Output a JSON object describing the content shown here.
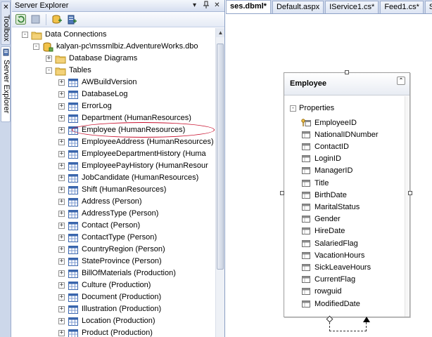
{
  "side_strip": {
    "toolbox_label": "Toolbox",
    "server_explorer_label": "Server Explorer"
  },
  "panel": {
    "title": "Server Explorer"
  },
  "tree": [
    {
      "label": "Data Connections",
      "icon": "folder-icon",
      "indent": 0,
      "exp": "-"
    },
    {
      "label": "kalyan-pc\\mssmlbiz.AdventureWorks.dbo",
      "icon": "db-connection-icon",
      "indent": 1,
      "exp": "-"
    },
    {
      "label": "Database Diagrams",
      "icon": "folder-icon",
      "indent": 2,
      "exp": "+"
    },
    {
      "label": "Tables",
      "icon": "folder-icon",
      "indent": 2,
      "exp": "-"
    },
    {
      "label": "AWBuildVersion",
      "icon": "table-icon",
      "indent": 3,
      "exp": "+"
    },
    {
      "label": "DatabaseLog",
      "icon": "table-icon",
      "indent": 3,
      "exp": "+"
    },
    {
      "label": "ErrorLog",
      "icon": "table-icon",
      "indent": 3,
      "exp": "+"
    },
    {
      "label": "Department (HumanResources)",
      "icon": "table-icon",
      "indent": 3,
      "exp": "+"
    },
    {
      "label": "Employee (HumanResources)",
      "icon": "table-icon",
      "indent": 3,
      "exp": "+"
    },
    {
      "label": "EmployeeAddress (HumanResources)",
      "icon": "table-icon",
      "indent": 3,
      "exp": "+"
    },
    {
      "label": "EmployeeDepartmentHistory (Huma",
      "icon": "table-icon",
      "indent": 3,
      "exp": "+"
    },
    {
      "label": "EmployeePayHistory (HumanResour",
      "icon": "table-icon",
      "indent": 3,
      "exp": "+"
    },
    {
      "label": "JobCandidate (HumanResources)",
      "icon": "table-icon",
      "indent": 3,
      "exp": "+"
    },
    {
      "label": "Shift (HumanResources)",
      "icon": "table-icon",
      "indent": 3,
      "exp": "+"
    },
    {
      "label": "Address (Person)",
      "icon": "table-icon",
      "indent": 3,
      "exp": "+"
    },
    {
      "label": "AddressType (Person)",
      "icon": "table-icon",
      "indent": 3,
      "exp": "+"
    },
    {
      "label": "Contact (Person)",
      "icon": "table-icon",
      "indent": 3,
      "exp": "+"
    },
    {
      "label": "ContactType (Person)",
      "icon": "table-icon",
      "indent": 3,
      "exp": "+"
    },
    {
      "label": "CountryRegion (Person)",
      "icon": "table-icon",
      "indent": 3,
      "exp": "+"
    },
    {
      "label": "StateProvince (Person)",
      "icon": "table-icon",
      "indent": 3,
      "exp": "+"
    },
    {
      "label": "BillOfMaterials (Production)",
      "icon": "table-icon",
      "indent": 3,
      "exp": "+"
    },
    {
      "label": "Culture (Production)",
      "icon": "table-icon",
      "indent": 3,
      "exp": "+"
    },
    {
      "label": "Document (Production)",
      "icon": "table-icon",
      "indent": 3,
      "exp": "+"
    },
    {
      "label": "Illustration (Production)",
      "icon": "table-icon",
      "indent": 3,
      "exp": "+"
    },
    {
      "label": "Location (Production)",
      "icon": "table-icon",
      "indent": 3,
      "exp": "+"
    },
    {
      "label": "Product (Production)",
      "icon": "table-icon",
      "indent": 3,
      "exp": "+"
    }
  ],
  "tabs": [
    {
      "label": "ses.dbml*",
      "active": true
    },
    {
      "label": "Default.aspx",
      "active": false
    },
    {
      "label": "IService1.cs*",
      "active": false
    },
    {
      "label": "Feed1.cs*",
      "active": false
    },
    {
      "label": "Start P",
      "active": false
    }
  ],
  "entity": {
    "title": "Employee",
    "section": "Properties",
    "properties": [
      {
        "name": "EmployeeID",
        "key": true
      },
      {
        "name": "NationalIDNumber",
        "key": false
      },
      {
        "name": "ContactID",
        "key": false
      },
      {
        "name": "LoginID",
        "key": false
      },
      {
        "name": "ManagerID",
        "key": false
      },
      {
        "name": "Title",
        "key": false
      },
      {
        "name": "BirthDate",
        "key": false
      },
      {
        "name": "MaritalStatus",
        "key": false
      },
      {
        "name": "Gender",
        "key": false
      },
      {
        "name": "HireDate",
        "key": false
      },
      {
        "name": "SalariedFlag",
        "key": false
      },
      {
        "name": "VacationHours",
        "key": false
      },
      {
        "name": "SickLeaveHours",
        "key": false
      },
      {
        "name": "CurrentFlag",
        "key": false
      },
      {
        "name": "rowguid",
        "key": false
      },
      {
        "name": "ModifiedDate",
        "key": false
      }
    ]
  }
}
